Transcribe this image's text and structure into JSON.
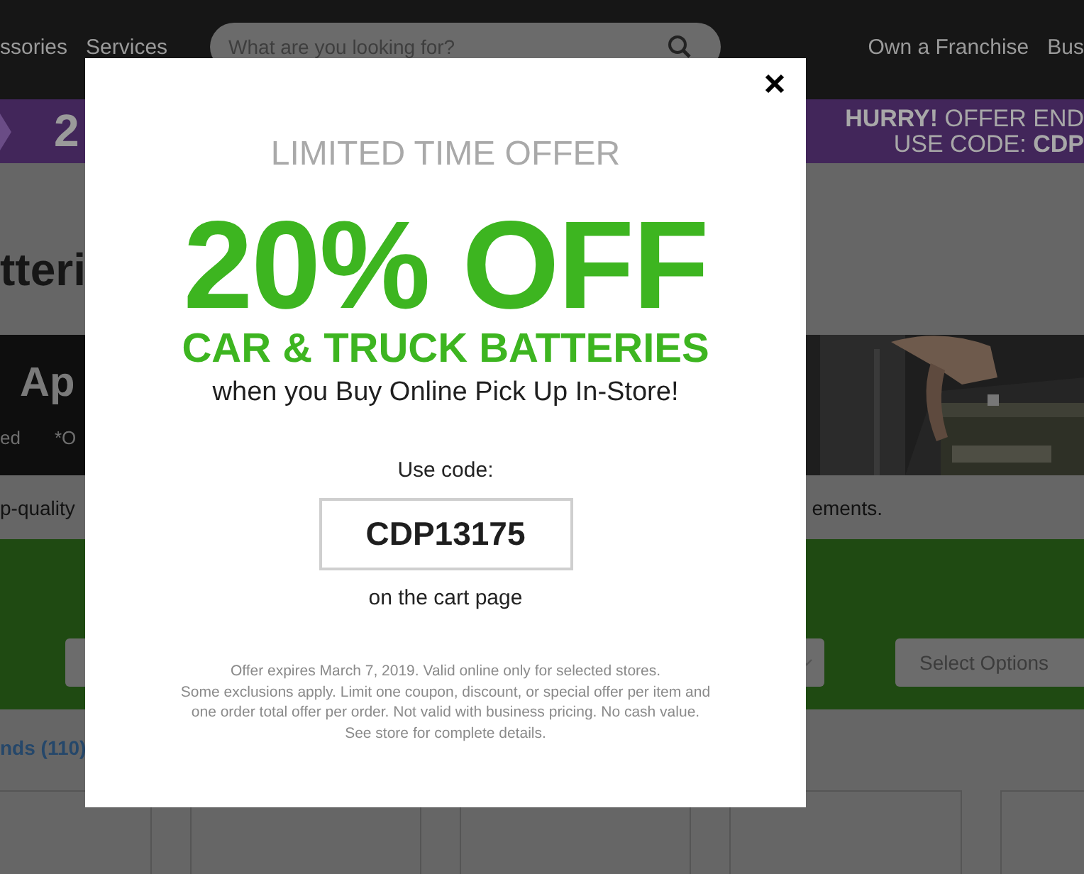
{
  "header": {
    "nav_left": [
      "ssories",
      "Services"
    ],
    "search": {
      "placeholder": "What are you looking for?"
    },
    "nav_right": [
      "Own a Franchise",
      "Bus"
    ]
  },
  "promo_banner": {
    "left_text": "2",
    "right_lines": [
      "**HURRY!** OFFER END",
      "USE CODE: **CDP**"
    ]
  },
  "page_title": "tteri",
  "hero": {
    "title": "Ap",
    "notes": [
      "ed",
      "*O"
    ]
  },
  "description": {
    "left": "p-quality",
    "right": "ements."
  },
  "filters": {
    "select_label": "Select Options"
  },
  "brands_link": "nds (110)",
  "modal": {
    "kicker": "LIMITED TIME OFFER",
    "headline": "20% OFF",
    "subhead": "CAR & TRUCK BATTERIES",
    "tagline": "when you Buy Online Pick Up In-Store!",
    "code_label": "Use code:",
    "code": "CDP13175",
    "code_note": "on the cart page",
    "fine_print": [
      "Offer expires March 7, 2019. Valid online only for selected stores.",
      "Some exclusions apply. Limit one coupon, discount, or special offer per item and",
      "one order total offer per order. Not valid with business pricing. No cash value.",
      "See store for complete details."
    ]
  }
}
